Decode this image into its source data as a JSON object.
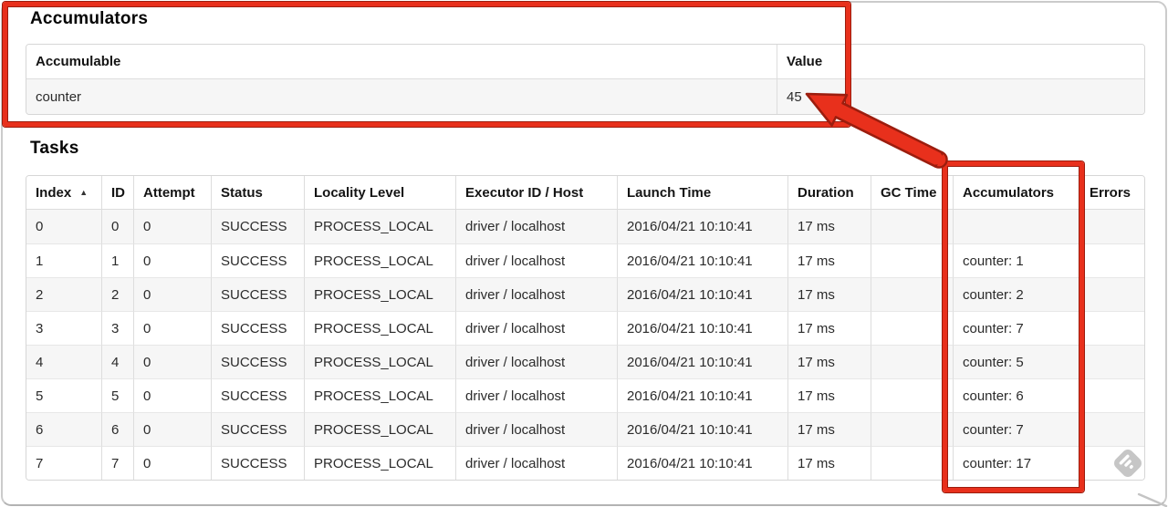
{
  "accumulators_section": {
    "title": "Accumulators",
    "table": {
      "headers": [
        "Accumulable",
        "Value"
      ],
      "rows": [
        [
          "counter",
          "45"
        ]
      ]
    }
  },
  "tasks_section": {
    "title": "Tasks",
    "table": {
      "headers": [
        "Index",
        "ID",
        "Attempt",
        "Status",
        "Locality Level",
        "Executor ID / Host",
        "Launch Time",
        "Duration",
        "GC Time",
        "Accumulators",
        "Errors"
      ],
      "sort_icon": "▲",
      "sorted_column": "Index",
      "rows": [
        [
          "0",
          "0",
          "0",
          "SUCCESS",
          "PROCESS_LOCAL",
          "driver / localhost",
          "2016/04/21 10:10:41",
          "17 ms",
          "",
          "",
          ""
        ],
        [
          "1",
          "1",
          "0",
          "SUCCESS",
          "PROCESS_LOCAL",
          "driver / localhost",
          "2016/04/21 10:10:41",
          "17 ms",
          "",
          "counter: 1",
          ""
        ],
        [
          "2",
          "2",
          "0",
          "SUCCESS",
          "PROCESS_LOCAL",
          "driver / localhost",
          "2016/04/21 10:10:41",
          "17 ms",
          "",
          "counter: 2",
          ""
        ],
        [
          "3",
          "3",
          "0",
          "SUCCESS",
          "PROCESS_LOCAL",
          "driver / localhost",
          "2016/04/21 10:10:41",
          "17 ms",
          "",
          "counter: 7",
          ""
        ],
        [
          "4",
          "4",
          "0",
          "SUCCESS",
          "PROCESS_LOCAL",
          "driver / localhost",
          "2016/04/21 10:10:41",
          "17 ms",
          "",
          "counter: 5",
          ""
        ],
        [
          "5",
          "5",
          "0",
          "SUCCESS",
          "PROCESS_LOCAL",
          "driver / localhost",
          "2016/04/21 10:10:41",
          "17 ms",
          "",
          "counter: 6",
          ""
        ],
        [
          "6",
          "6",
          "0",
          "SUCCESS",
          "PROCESS_LOCAL",
          "driver / localhost",
          "2016/04/21 10:10:41",
          "17 ms",
          "",
          "counter: 7",
          ""
        ],
        [
          "7",
          "7",
          "0",
          "SUCCESS",
          "PROCESS_LOCAL",
          "driver / localhost",
          "2016/04/21 10:10:41",
          "17 ms",
          "",
          "counter: 17",
          ""
        ]
      ]
    }
  },
  "annotations": {
    "highlight_color": "#e8301c",
    "highlight_outline": "#9c1d0e",
    "boxed_regions": [
      "accumulators-section",
      "tasks-accumulators-column"
    ],
    "arrow_points_at": "45"
  },
  "watermark": {
    "icon": "skitch-logo",
    "color": "#c6c6c6"
  }
}
